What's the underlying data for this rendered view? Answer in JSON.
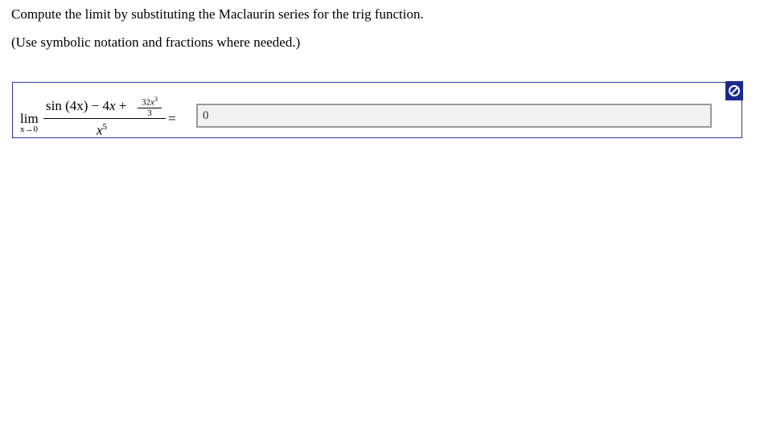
{
  "question": {
    "line1": "Compute the limit by substituting the Maclaurin series for the trig function.",
    "line2": "(Use symbolic notation and fractions where needed.)"
  },
  "expression": {
    "lim_word": "lim",
    "lim_sub": "x→0",
    "numerator_sin": "sin",
    "numerator_arg": "(4x)",
    "numerator_minus": " − 4",
    "numerator_x": "x",
    "numerator_plus": " +",
    "inner_num_coef": "32",
    "inner_num_var": "x",
    "inner_num_exp": "3",
    "inner_den": "3",
    "den_var": "x",
    "den_exp": "5",
    "equals": "="
  },
  "answer": {
    "value": "0"
  },
  "status": {
    "icon": "not-allowed-icon",
    "color": "#1b2a8f"
  }
}
